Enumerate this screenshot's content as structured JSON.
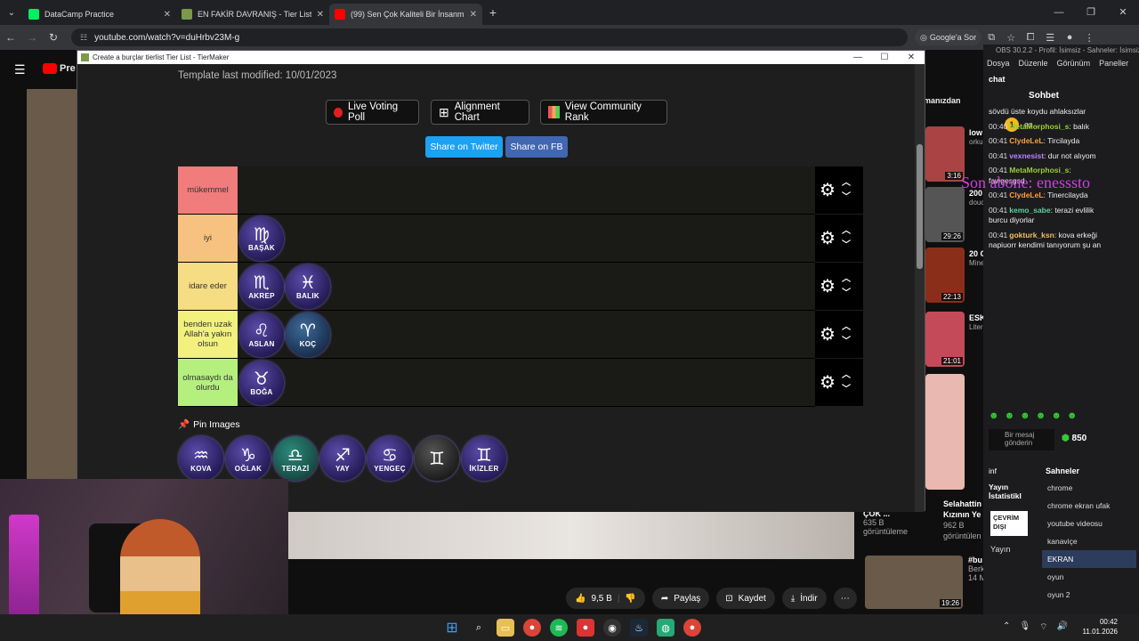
{
  "browser": {
    "tabs": [
      {
        "title": "DataCamp Practice",
        "color": "#03ef62"
      },
      {
        "title": "EN FAKİR DAVRANIŞ - Tier List",
        "color": "#7a9a4a"
      },
      {
        "title": "(99) Sen Çok Kaliteli Bir İnsanm",
        "color": "#ff0000"
      }
    ],
    "url": "youtube.com/watch?v=duHrbv23M-g",
    "google_sor": "Google'a Sor"
  },
  "tiermaker": {
    "window_title": "Create a burçlar tierlist Tier List - TierMaker",
    "modified": "Template last modified: 10/01/2023",
    "buttons": {
      "live_voting": "Live Voting Poll",
      "alignment": "Alignment Chart",
      "community": "View Community Rank",
      "twitter": "Share on Twitter",
      "fb": "Share on FB"
    },
    "tiers": [
      {
        "label": "mükemmel",
        "color": "#f07c7c",
        "items": []
      },
      {
        "label": "iyi",
        "color": "#f7c27f",
        "items": [
          {
            "name": "BAŞAK",
            "symbol": "♍"
          }
        ]
      },
      {
        "label": "idare eder",
        "color": "#f6dc83",
        "items": [
          {
            "name": "AKREP",
            "symbol": "♏"
          },
          {
            "name": "BALIK",
            "symbol": "♓"
          }
        ]
      },
      {
        "label": "benden uzak Allah'a yakın olsun",
        "color": "#f2f17e",
        "items": [
          {
            "name": "ASLAN",
            "symbol": "♌"
          },
          {
            "name": "KOÇ",
            "symbol": "♈"
          }
        ]
      },
      {
        "label": "olmasaydı da olurdu",
        "color": "#b5f07e",
        "items": [
          {
            "name": "BOĞA",
            "symbol": "♉"
          }
        ]
      }
    ],
    "pin_label": "Pin Images",
    "pool": [
      {
        "name": "KOVA",
        "symbol": "♒"
      },
      {
        "name": "OĞLAK",
        "symbol": "♑"
      },
      {
        "name": "TERAZİ",
        "symbol": "♎"
      },
      {
        "name": "YAY",
        "symbol": "♐"
      },
      {
        "name": "YENGEÇ",
        "symbol": "♋"
      },
      {
        "name": "",
        "symbol": "♊"
      },
      {
        "name": "İKİZLER",
        "symbol": "♊"
      }
    ]
  },
  "youtube": {
    "chips": "manızdan",
    "likes": "9,5 B",
    "share": "Paylaş",
    "save": "Kaydet",
    "download": "İndir",
    "recs": [
      {
        "title": "low",
        "meta": "orku",
        "dur": "3:16"
      },
      {
        "title": "200",
        "meta": "douc",
        "dur": "29:26"
      },
      {
        "title": "20 C Bun",
        "meta": "Mine 186",
        "dur": "22:13"
      },
      {
        "title": "ESK FİLM",
        "meta": "Liter 1,4 M",
        "dur": "21:01"
      }
    ],
    "bottom_rec1": {
      "title": "ÇOK ...",
      "views": "635 B görüntüleme"
    },
    "bottom_rec2": {
      "title": "Selahattin Kızının Ye",
      "views": "962 B görüntülen"
    },
    "bottom_rec3": {
      "title": "#bu",
      "meta": "Berk 14 M",
      "dur": "19:26"
    }
  },
  "obs": {
    "title": "OBS 30.2.2 - Profil: İsimsiz - Sahneler: İsimsiz",
    "menu": [
      "Dosya",
      "Düzenle",
      "Görünüm",
      "Paneller"
    ],
    "chat_label": "chat",
    "sohbet": "Sohbet",
    "top_user": "es...",
    "messages": [
      {
        "time": "",
        "user": "",
        "color": "#fff",
        "text": "sövdü üste koydu ahlaksızlar"
      },
      {
        "time": "00:40",
        "user": "MetaMorphosi_s",
        "color": "#9acd32",
        "text": "balık"
      },
      {
        "time": "00:41",
        "user": "ClydeLeL",
        "color": "#ff9f40",
        "text": "Tircilayda"
      },
      {
        "time": "00:41",
        "user": "vexnesist",
        "color": "#c080ff",
        "text": "dur not alıyom"
      },
      {
        "time": "00:41",
        "user": "MetaMorphosi_s",
        "color": "#9acd32",
        "text": "fawgesgsd"
      },
      {
        "time": "00:41",
        "user": "ClydeLeL",
        "color": "#ff9f40",
        "text": "Tinercilayda"
      },
      {
        "time": "00:41",
        "user": "kemo_sabe",
        "color": "#5fd0a0",
        "text": "terazi evlilik burcu diyorlar"
      },
      {
        "time": "00:41",
        "user": "gokturk_ksn",
        "color": "#f0c060",
        "text": "kova erkeği napiuorr kendimi tanıyorum şu an"
      }
    ],
    "son_abone": "Son abone: enesssto",
    "send": "Bir mesaj gönderin",
    "points": "850",
    "info": "inf",
    "stats": "Yayın İstatistikl",
    "offline": "ÇEVRİM DIŞI",
    "yayin": "Yayın",
    "scenes_header": "Sahneler",
    "scenes": [
      "chrome",
      "chrome ekran ufak",
      "youtube videosu",
      "kanaviçe",
      "EKRAN",
      "oyun",
      "oyun 2"
    ],
    "selected_scene": "EKRAN"
  },
  "taskbar": {
    "time": "00:42",
    "date": "11.01.2026"
  }
}
